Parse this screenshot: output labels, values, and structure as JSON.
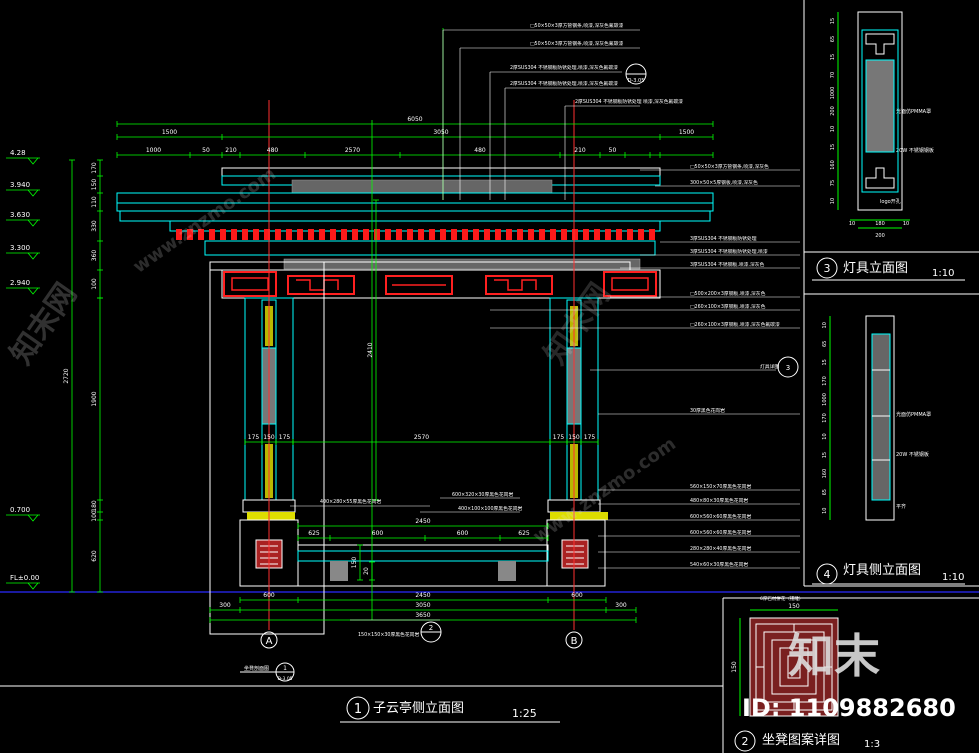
{
  "colors": {
    "background": "#000000",
    "structure": "#ffffff",
    "cyan": "#00ffff",
    "dimension": "#00ff00",
    "red": "#ff0000",
    "yellow": "#ffff00",
    "grid_axis": "#0000ff"
  },
  "main_view": {
    "number": "1",
    "title": "子云亭侧立面图",
    "scale": "1:25"
  },
  "lamp_elevation": {
    "number": "3",
    "title": "灯具立面图",
    "scale": "1:10",
    "dims_vertical": [
      "15",
      "65",
      "15",
      "70",
      "1000",
      "200",
      "10",
      "15",
      "160",
      "75",
      "10"
    ],
    "dims_horizontal": [
      "10",
      "180",
      "10",
      "200"
    ],
    "notes": [
      "光面仿PMMA罩",
      "20W 不锈钢钢板",
      "logo开孔"
    ]
  },
  "lamp_side": {
    "number": "4",
    "title": "灯具侧立面图",
    "scale": "1:10",
    "dims_vertical": [
      "10",
      "65",
      "15",
      "170",
      "1000",
      "170",
      "10",
      "15",
      "160",
      "65",
      "10"
    ],
    "notes": [
      "光面仿PMMA罩",
      "20W 不锈钢板",
      "平齐"
    ]
  },
  "seat_pattern": {
    "number": "2",
    "title": "坐凳图案详图",
    "scale": "1:3",
    "dim_top": "150",
    "dim_left": "150",
    "note": "6厚石材拼花（镂雕）"
  },
  "levels": [
    "4.28",
    "3.940",
    "3.630",
    "3.300",
    "2.940",
    "0.700",
    "FL±0.00"
  ],
  "top_dims": [
    "6050",
    "1500",
    "3050",
    "1500",
    "1000",
    "50",
    "210",
    "480",
    "2570",
    "480",
    "210",
    "50"
  ],
  "left_dims": [
    "170",
    "150",
    "110",
    "330",
    "360",
    "100",
    "2720",
    "1900",
    "180",
    "100",
    "620"
  ],
  "mid_dims": [
    "175",
    "150",
    "175",
    "2570",
    "175",
    "150",
    "175",
    "2450",
    "625",
    "600",
    "600",
    "625",
    "2410",
    "150",
    "20"
  ],
  "bottom_dims": [
    "600",
    "2450",
    "600",
    "300",
    "3050",
    "300",
    "3650"
  ],
  "axes": [
    "A",
    "B"
  ],
  "top_callouts": [
    "□50×50×3厚方管钢条,喷漆,深灰色氟碳漆",
    "□50×50×3厚方管钢条,喷漆,深灰色氟碳漆",
    "2厚SUS304 不锈钢板防锈处理,喷漆,深灰色氟碳漆",
    "2厚SUS304 不锈钢板防锈处理,喷漆,深灰色氟碳漆",
    "2厚SUS304 不锈钢板防锈处理 喷漆,深灰色氟碳漆"
  ],
  "callout_detail": "D-3.05",
  "right_callouts": [
    "□50×50×3厚方管钢条,喷漆,深灰色",
    "300×50×5厚钢板,喷漆,深灰色",
    "3厚SUS304 不锈钢板防锈处理",
    "3厚SUS304 不锈钢板防锈处理,喷漆",
    "3厚SUS304 不锈钢板,喷漆,深灰色",
    "□500×200×3厚钢板,喷漆,深灰色",
    "□260×100×3厚钢板,喷漆,深灰色",
    "□260×100×3厚钢板,喷漆,深灰色氟碳漆",
    "灯具详图",
    "30厚黑色花岗岩",
    "560×150×70厚黑色花岗岩",
    "480×80×30厚黑色花岗岩",
    "600×560×60厚黑色花岗岩",
    "600×560×60厚黑色花岗岩",
    "280×280×40厚黑色花岗岩",
    "540×60×30厚黑色花岗岩"
  ],
  "seat_callouts": [
    "400×280×55厚黑色花岗岩",
    "600×320×30厚黑色花岗岩",
    "400×100×100厚黑色花岗岩",
    "150×150×30厚黑色花岗岩"
  ],
  "lamp_ref": "3",
  "bench_ref": "2",
  "bottom_ref": {
    "label": "坐凳剖面图",
    "number": "1",
    "sheet": "D-3.05"
  },
  "watermarks": [
    "知末网",
    "www.znzmo.com"
  ],
  "brand": {
    "logo_text": "知末",
    "id_label": "ID: 1109882680"
  }
}
